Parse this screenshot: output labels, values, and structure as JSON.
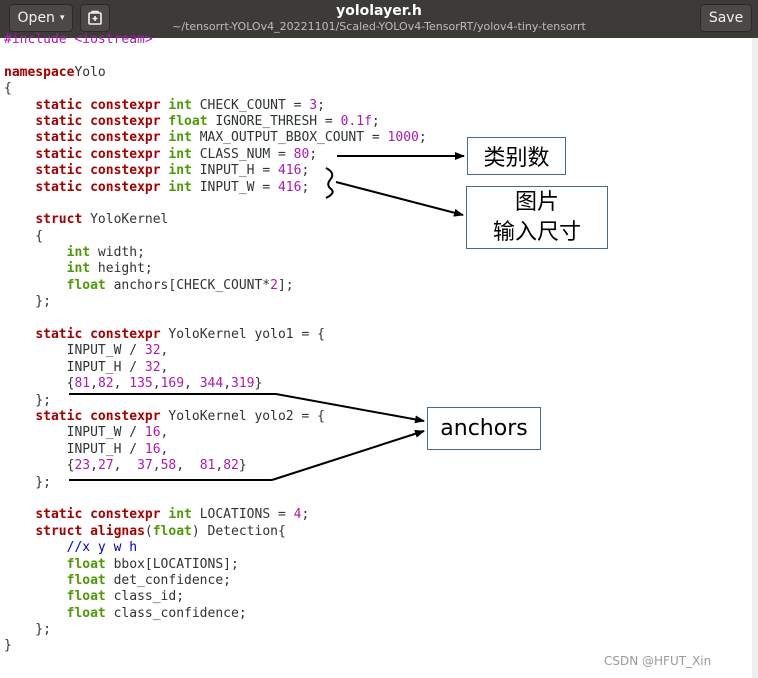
{
  "header": {
    "open_label": "Open",
    "open_chevron": "▾",
    "new_doc_icon": "new-document-icon",
    "title": "yololayer.h",
    "subtitle": "~/tensorrt-YOLOv4_20221101/Scaled-YOLOv4-TensorRT/yolov4-tiny-tensorrt",
    "save_label": "Save"
  },
  "code_lines": [
    [
      [
        "pp",
        "#include <iostream>"
      ]
    ],
    [],
    [
      [
        "kw",
        "namespace"
      ],
      [
        "",
        "Yolo"
      ]
    ],
    [
      [
        "",
        "{"
      ]
    ],
    [
      [
        "",
        "    "
      ],
      [
        "kw",
        "static"
      ],
      [
        "",
        " "
      ],
      [
        "kw",
        "constexpr"
      ],
      [
        "",
        " "
      ],
      [
        "ty",
        "int"
      ],
      [
        "",
        " CHECK_COUNT = "
      ],
      [
        "num",
        "3"
      ],
      [
        "",
        ";"
      ]
    ],
    [
      [
        "",
        "    "
      ],
      [
        "kw",
        "static"
      ],
      [
        "",
        " "
      ],
      [
        "kw",
        "constexpr"
      ],
      [
        "",
        " "
      ],
      [
        "ty",
        "float"
      ],
      [
        "",
        " IGNORE_THRESH = "
      ],
      [
        "num",
        "0.1f"
      ],
      [
        "",
        ";"
      ]
    ],
    [
      [
        "",
        "    "
      ],
      [
        "kw",
        "static"
      ],
      [
        "",
        " "
      ],
      [
        "kw",
        "constexpr"
      ],
      [
        "",
        " "
      ],
      [
        "ty",
        "int"
      ],
      [
        "",
        " MAX_OUTPUT_BBOX_COUNT = "
      ],
      [
        "num",
        "1000"
      ],
      [
        "",
        ";"
      ]
    ],
    [
      [
        "",
        "    "
      ],
      [
        "kw",
        "static"
      ],
      [
        "",
        " "
      ],
      [
        "kw",
        "constexpr"
      ],
      [
        "",
        " "
      ],
      [
        "ty",
        "int"
      ],
      [
        "",
        " CLASS_NUM = "
      ],
      [
        "num",
        "80"
      ],
      [
        "",
        ";"
      ]
    ],
    [
      [
        "",
        "    "
      ],
      [
        "kw",
        "static"
      ],
      [
        "",
        " "
      ],
      [
        "kw",
        "constexpr"
      ],
      [
        "",
        " "
      ],
      [
        "ty",
        "int"
      ],
      [
        "",
        " INPUT_H = "
      ],
      [
        "num",
        "416"
      ],
      [
        "",
        ";"
      ]
    ],
    [
      [
        "",
        "    "
      ],
      [
        "kw",
        "static"
      ],
      [
        "",
        " "
      ],
      [
        "kw",
        "constexpr"
      ],
      [
        "",
        " "
      ],
      [
        "ty",
        "int"
      ],
      [
        "",
        " INPUT_W = "
      ],
      [
        "num",
        "416"
      ],
      [
        "",
        ";"
      ]
    ],
    [],
    [
      [
        "",
        "    "
      ],
      [
        "kw",
        "struct"
      ],
      [
        "",
        " YoloKernel"
      ]
    ],
    [
      [
        "",
        "    {"
      ]
    ],
    [
      [
        "",
        "        "
      ],
      [
        "ty",
        "int"
      ],
      [
        "",
        " width;"
      ]
    ],
    [
      [
        "",
        "        "
      ],
      [
        "ty",
        "int"
      ],
      [
        "",
        " height;"
      ]
    ],
    [
      [
        "",
        "        "
      ],
      [
        "ty",
        "float"
      ],
      [
        "",
        " anchors[CHECK_COUNT*"
      ],
      [
        "num",
        "2"
      ],
      [
        "",
        "];"
      ]
    ],
    [
      [
        "",
        "    };"
      ]
    ],
    [],
    [
      [
        "",
        "    "
      ],
      [
        "kw",
        "static"
      ],
      [
        "",
        " "
      ],
      [
        "kw",
        "constexpr"
      ],
      [
        "",
        " YoloKernel yolo1 = {"
      ]
    ],
    [
      [
        "",
        "        INPUT_W / "
      ],
      [
        "num",
        "32"
      ],
      [
        "",
        ","
      ]
    ],
    [
      [
        "",
        "        INPUT_H / "
      ],
      [
        "num",
        "32"
      ],
      [
        "",
        ","
      ]
    ],
    [
      [
        "",
        "        {"
      ],
      [
        "num",
        "81"
      ],
      [
        "",
        ","
      ],
      [
        "num",
        "82"
      ],
      [
        "",
        ", "
      ],
      [
        "num",
        "135"
      ],
      [
        "",
        ","
      ],
      [
        "num",
        "169"
      ],
      [
        "",
        ", "
      ],
      [
        "num",
        "344"
      ],
      [
        "",
        ","
      ],
      [
        "num",
        "319"
      ],
      [
        "",
        "}"
      ]
    ],
    [
      [
        "",
        "    };"
      ]
    ],
    [
      [
        "",
        "    "
      ],
      [
        "kw",
        "static"
      ],
      [
        "",
        " "
      ],
      [
        "kw",
        "constexpr"
      ],
      [
        "",
        " YoloKernel yolo2 = {"
      ]
    ],
    [
      [
        "",
        "        INPUT_W / "
      ],
      [
        "num",
        "16"
      ],
      [
        "",
        ","
      ]
    ],
    [
      [
        "",
        "        INPUT_H / "
      ],
      [
        "num",
        "16"
      ],
      [
        "",
        ","
      ]
    ],
    [
      [
        "",
        "        {"
      ],
      [
        "num",
        "23"
      ],
      [
        "",
        ","
      ],
      [
        "num",
        "27"
      ],
      [
        "",
        ",  "
      ],
      [
        "num",
        "37"
      ],
      [
        "",
        ","
      ],
      [
        "num",
        "58"
      ],
      [
        "",
        ",  "
      ],
      [
        "num",
        "81"
      ],
      [
        "",
        ","
      ],
      [
        "num",
        "82"
      ],
      [
        "",
        "}"
      ]
    ],
    [
      [
        "",
        "    };"
      ]
    ],
    [],
    [
      [
        "",
        "    "
      ],
      [
        "kw",
        "static"
      ],
      [
        "",
        " "
      ],
      [
        "kw",
        "constexpr"
      ],
      [
        "",
        " "
      ],
      [
        "ty",
        "int"
      ],
      [
        "",
        " LOCATIONS = "
      ],
      [
        "num",
        "4"
      ],
      [
        "",
        ";"
      ]
    ],
    [
      [
        "",
        "    "
      ],
      [
        "kw",
        "struct"
      ],
      [
        "",
        " "
      ],
      [
        "kw",
        "alignas"
      ],
      [
        "",
        "("
      ],
      [
        "ty",
        "float"
      ],
      [
        "",
        ") Detection{"
      ]
    ],
    [
      [
        "",
        "        "
      ],
      [
        "cm",
        "//x y w h"
      ]
    ],
    [
      [
        "",
        "        "
      ],
      [
        "ty",
        "float"
      ],
      [
        "",
        " bbox[LOCATIONS];"
      ]
    ],
    [
      [
        "",
        "        "
      ],
      [
        "ty",
        "float"
      ],
      [
        "",
        " det_confidence;"
      ]
    ],
    [
      [
        "",
        "        "
      ],
      [
        "ty",
        "float"
      ],
      [
        "",
        " class_id;"
      ]
    ],
    [
      [
        "",
        "        "
      ],
      [
        "ty",
        "float"
      ],
      [
        "",
        " class_confidence;"
      ]
    ],
    [
      [
        "",
        "    };"
      ]
    ],
    [
      [
        "",
        "}"
      ]
    ]
  ],
  "annotations": {
    "class_count_label": "类别数",
    "image_input_size_line1": "图片",
    "image_input_size_line2": "输入尺寸",
    "anchors_label": "anchors"
  },
  "watermark": "CSDN @HFUT_Xin"
}
